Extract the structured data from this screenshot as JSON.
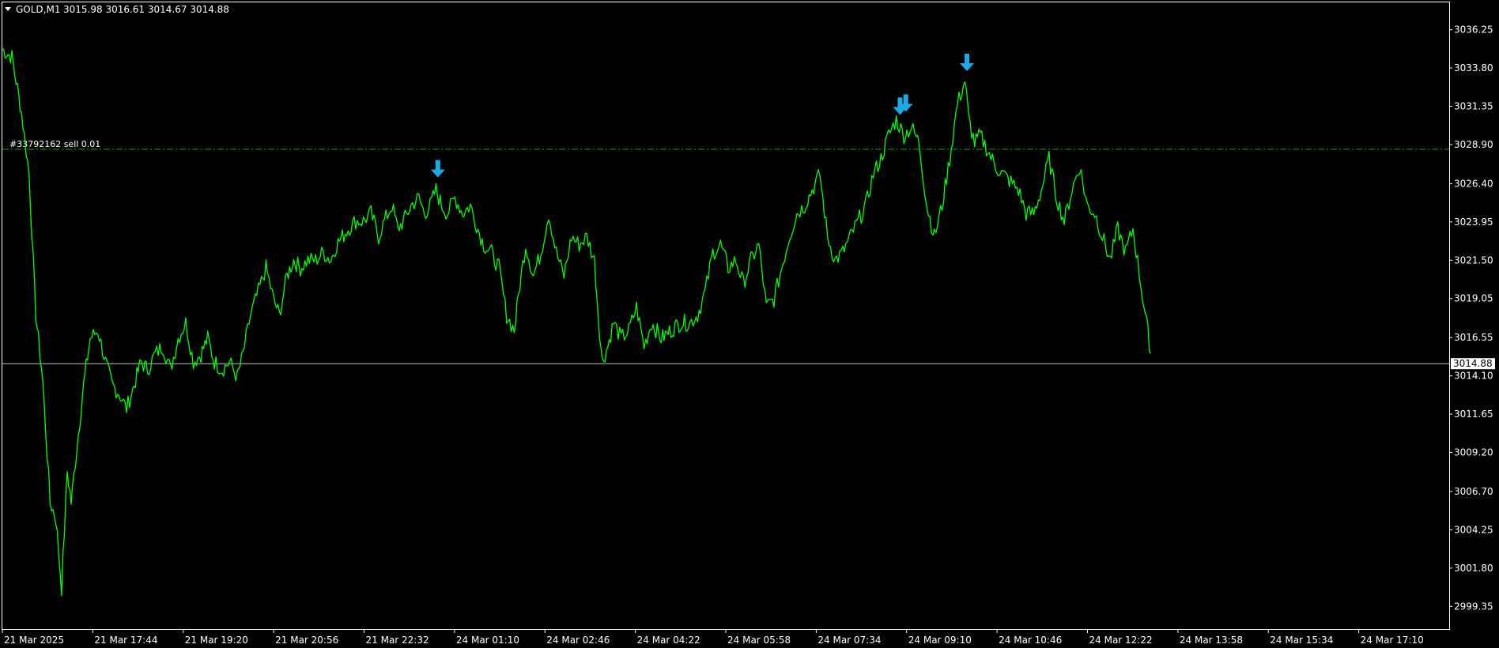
{
  "header": {
    "symbol_timeframe": "GOLD,M1",
    "ohlc": "3015.98 3016.61 3014.67 3014.88"
  },
  "colors": {
    "background": "#000000",
    "price_line": "#00ff00",
    "frame": "#ffffff",
    "bid_line": "#c0c0c0",
    "order_line": "#00b000",
    "arrow": "#1ea8e6"
  },
  "order": {
    "label": "#33792162 sell 0.01",
    "price": 3028.6
  },
  "bid": {
    "label": "3014.88",
    "price": 3014.88
  },
  "chart_data": {
    "type": "line",
    "ylim": [
      2997.9,
      3038.0
    ],
    "y_ticks": [
      "3036.25",
      "3033.80",
      "3031.35",
      "3028.90",
      "3026.40",
      "3023.95",
      "3021.50",
      "3019.05",
      "3016.55",
      "3014.10",
      "3011.65",
      "3009.20",
      "3006.70",
      "3004.25",
      "3001.80",
      "2999.35"
    ],
    "x_ticks": [
      "21 Mar 2025",
      "21 Mar 17:44",
      "21 Mar 19:20",
      "21 Mar 20:56",
      "21 Mar 22:32",
      "24 Mar 01:10",
      "24 Mar 02:46",
      "24 Mar 04:22",
      "24 Mar 05:58",
      "24 Mar 07:34",
      "24 Mar 09:10",
      "24 Mar 10:46",
      "24 Mar 12:22",
      "24 Mar 13:58",
      "24 Mar 15:34",
      "24 Mar 17:10"
    ],
    "xlim": [
      0,
      1515
    ],
    "x": [
      0,
      10,
      20,
      28,
      35,
      42,
      50,
      56,
      62,
      68,
      72,
      78,
      85,
      92,
      100,
      108,
      115,
      122,
      130,
      138,
      145,
      152,
      160,
      168,
      176,
      184,
      192,
      200,
      208,
      215,
      222,
      230,
      238,
      246,
      252,
      260,
      268,
      276,
      284,
      290,
      298,
      305,
      312,
      320,
      328,
      336,
      344,
      350,
      356,
      362,
      370,
      378,
      386,
      394,
      400,
      408,
      414,
      420,
      428,
      436,
      442,
      448,
      454,
      460,
      466,
      474,
      482,
      490,
      498,
      504,
      512,
      520,
      528,
      536,
      542,
      548,
      556,
      564,
      572,
      580,
      588,
      596,
      604,
      612,
      620,
      624,
      628,
      634,
      640,
      648,
      656,
      664,
      672,
      680,
      690,
      700,
      710,
      720,
      728,
      736,
      744,
      752,
      760,
      768,
      776,
      784,
      792,
      800,
      808,
      816,
      824,
      832,
      840,
      848,
      856,
      864,
      872,
      880,
      888,
      896,
      904,
      912,
      920,
      928,
      936,
      944,
      952,
      960,
      968,
      976,
      984,
      992,
      1000,
      1008,
      1012,
      1018,
      1024,
      1032,
      1040,
      1048,
      1056,
      1064,
      1072,
      1080,
      1088,
      1096,
      1104,
      1112,
      1120,
      1128,
      1136,
      1144,
      1152,
      1160,
      1168,
      1176,
      1184,
      1192,
      1198,
      1204,
      1210
    ],
    "y": [
      3035.0,
      3034.5,
      3031.0,
      3027.0,
      3018.0,
      3014.0,
      3006.0,
      3005.0,
      3000.5,
      3008.0,
      3006.0,
      3009.5,
      3013.5,
      3016.5,
      3017.0,
      3015.0,
      3013.5,
      3013.0,
      3012.0,
      3013.5,
      3015.0,
      3014.5,
      3015.5,
      3016.0,
      3014.5,
      3016.5,
      3017.5,
      3015.0,
      3015.5,
      3016.5,
      3015.0,
      3014.5,
      3015.0,
      3014.0,
      3015.5,
      3018.0,
      3019.5,
      3021.0,
      3019.0,
      3018.0,
      3020.5,
      3021.5,
      3021.0,
      3021.5,
      3021.5,
      3022.0,
      3021.5,
      3022.5,
      3023.0,
      3023.5,
      3024.0,
      3024.0,
      3024.5,
      3023.0,
      3024.0,
      3025.0,
      3023.5,
      3024.0,
      3025.0,
      3025.5,
      3024.5,
      3025.0,
      3026.0,
      3025.0,
      3024.5,
      3025.5,
      3024.5,
      3025.0,
      3023.5,
      3022.5,
      3022.0,
      3021.0,
      3018.0,
      3017.0,
      3020.0,
      3022.5,
      3020.5,
      3022.0,
      3024.5,
      3022.0,
      3020.5,
      3023.0,
      3022.5,
      3023.0,
      3021.5,
      3018.0,
      3015.0,
      3016.0,
      3017.5,
      3016.5,
      3017.0,
      3018.5,
      3016.0,
      3017.5,
      3016.5,
      3017.0,
      3017.5,
      3017.5,
      3018.0,
      3019.5,
      3022.0,
      3022.5,
      3021.0,
      3021.5,
      3020.0,
      3021.5,
      3022.5,
      3018.5,
      3019.0,
      3021.0,
      3023.0,
      3024.5,
      3025.0,
      3026.0,
      3027.0,
      3023.0,
      3021.5,
      3022.0,
      3023.0,
      3024.0,
      3025.0,
      3027.0,
      3028.0,
      3029.5,
      3030.5,
      3029.5,
      3030.0,
      3029.0,
      3025.0,
      3023.0,
      3025.0,
      3028.0,
      3031.5,
      3033.0,
      3030.5,
      3029.0,
      3029.5,
      3028.5,
      3027.5,
      3027.0,
      3026.5,
      3026.0,
      3024.5,
      3024.5,
      3026.0,
      3028.0,
      3025.5,
      3024.0,
      3026.0,
      3027.5,
      3025.0,
      3024.5,
      3023.0,
      3021.5,
      3023.5,
      3022.0,
      3023.5,
      3020.0,
      3017.5,
      3015.0
    ]
  },
  "arrows": [
    {
      "x": 456,
      "price": 3026.6
    },
    {
      "x": 940,
      "price": 3030.6
    },
    {
      "x": 946,
      "price": 3030.8
    },
    {
      "x": 1010,
      "price": 3033.4
    }
  ]
}
